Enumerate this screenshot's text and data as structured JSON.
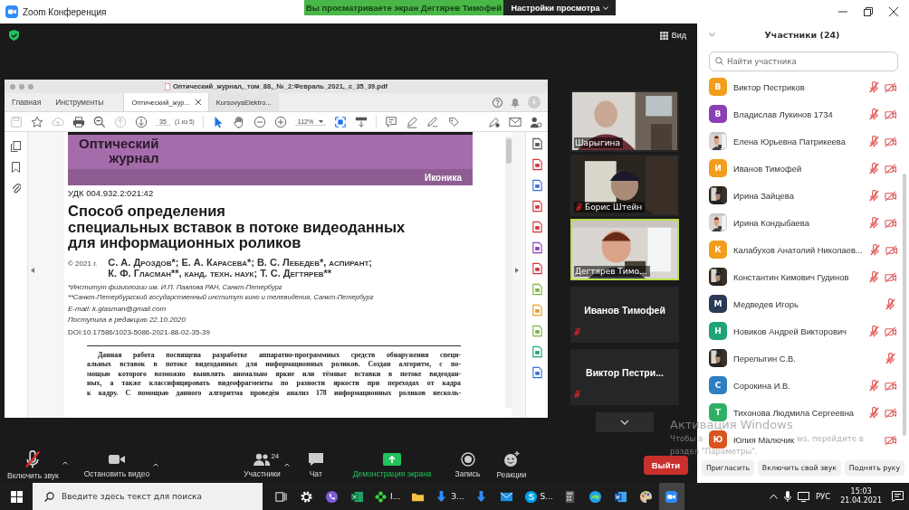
{
  "window": {
    "title": "Zoom Конференция"
  },
  "share_banner": {
    "text": "Вы просматриваете экран Дегтярев Тимофей",
    "view_options": "Настройки просмотра"
  },
  "view_button": "Вид",
  "pdf_viewer": {
    "title": "Оптический_журнал,_том_88,_№_2:Февраль_2021,_с_35_39.pdf",
    "nav": [
      {
        "label": "Главная"
      },
      {
        "label": "Инструменты"
      }
    ],
    "tabs": [
      {
        "label": "Оптический_жур...",
        "selected": true
      },
      {
        "label": "KursovyaElektro...",
        "selected": false
      }
    ],
    "page": "35",
    "page_count": "(1 из 5)",
    "zoom": "112%",
    "journal": {
      "name_lines": [
        "Оптический",
        "журнал"
      ],
      "section": "Иконика"
    },
    "udc": "УДК 004.932.2:021:42",
    "title_lines": [
      "Способ определения",
      "специальных вставок в потоке видеоданных",
      "для информационных роликов"
    ],
    "copyright": "© 2021 г.",
    "authors_lines": [
      "С. А. Дроздов*; Е. А. Карасева*; В. С. Лебедев*, аспирант;",
      "К. Ф. Гласман**, канд. техн. наук; Т. С. Дегтярев**"
    ],
    "affiliations": [
      "*Институт физиологии им. И.П. Павлова РАН, Санкт-Петербург",
      "**Санкт-Петербургский государственный институт кино и телевидения, Санкт-Петербург"
    ],
    "email": "E-mail: k.glasman@gmail.com",
    "received": "Поступила в редакцию 22.10.2020",
    "doi": "DOI:10.17586/1023-5086-2021-88-02-35-39",
    "abstract_lines": [
      "Данная работа посвящена разработке аппаратно-программных средств обнаружения специ-",
      "альных вставок в потоке видеоданных для информационных роликов. Создан алгоритм, с по-",
      "мощью которого возможно выявлять аномально яркие или тёмные вставки в потоке видеодан-",
      "ных, а также классифицировать видеофрагменты по разности яркости при переходах от кадра",
      "к кадру. С помощью данного алгоритма проведён анализ 178 информационных роликов несколь-"
    ]
  },
  "videos": [
    {
      "kind": "picture",
      "name": "Шарыгина",
      "muted": false,
      "active": false
    },
    {
      "kind": "picture",
      "name": "Борис Штейн",
      "muted": true,
      "active": false
    },
    {
      "kind": "picture",
      "name": "Дегтярев Тимо...",
      "muted": false,
      "active": true
    },
    {
      "kind": "name",
      "name": "Иванов Тимофей",
      "muted": true,
      "active": false
    },
    {
      "kind": "name",
      "name": "Виктор  Пестри...",
      "muted": true,
      "active": false
    }
  ],
  "participants": {
    "title": "Участники (24)",
    "search_placeholder": "Найти участника",
    "list": [
      {
        "kind": "letter",
        "initial": "В",
        "color": "#f29d1c",
        "name": "Виктор Пестриков",
        "mic_muted": true,
        "video_off": true
      },
      {
        "kind": "letter",
        "initial": "В",
        "color": "#8a3fb4",
        "name": "Владислав Лукинов 1734",
        "mic_muted": true,
        "video_off": true
      },
      {
        "name": "Елена Юрьевна Патрикеева",
        "mic_muted": true,
        "video_off": true
      },
      {
        "kind": "letter",
        "initial": "И",
        "color": "#f29d1c",
        "name": "Иванов Тимофей",
        "mic_muted": true,
        "video_off": true
      },
      {
        "name": "Ирина Зайцева",
        "mic_muted": true,
        "video_off": true
      },
      {
        "name": "Ирина Кондыбаева",
        "mic_muted": true,
        "video_off": true
      },
      {
        "kind": "letter",
        "initial": "К",
        "color": "#f29d1c",
        "name": "Калабухов Анатолий Николаев...",
        "mic_muted": true,
        "video_off": true
      },
      {
        "name": "Константин Кимович Гудинов",
        "mic_muted": true,
        "video_off": true
      },
      {
        "kind": "letter",
        "initial": "М",
        "color": "#2b3a55",
        "name": "Медведев Игорь",
        "mic_muted": true,
        "video_off": false
      },
      {
        "kind": "letter",
        "initial": "Н",
        "color": "#1fa37a",
        "name": "Новиков Андрей Викторович",
        "mic_muted": true,
        "video_off": true
      },
      {
        "name": "Перелыгин С.В.",
        "mic_muted": true,
        "video_off": false
      },
      {
        "kind": "letter",
        "initial": "С",
        "color": "#2d7fc1",
        "name": "Сорокина И.В.",
        "mic_muted": true,
        "video_off": true
      },
      {
        "kind": "letter",
        "initial": "Т",
        "color": "#2fb066",
        "name": "Тихонова Людмила Сергеевна",
        "mic_muted": true,
        "video_off": true
      },
      {
        "kind": "letter",
        "initial": "Ю",
        "color": "#d9541e",
        "name": "Юлия Малючик",
        "mic_muted": false,
        "video_off": true
      }
    ],
    "buttons": [
      "Пригласить",
      "Включить свой звук",
      "Поднять руку"
    ]
  },
  "toolbar": {
    "items": [
      {
        "kind": "mic",
        "label": "Включить звук",
        "muted": true,
        "caret": true
      },
      {
        "kind": "video",
        "label": "Остановить видео",
        "caret": true
      },
      {
        "kind": "participants",
        "label": "Участники",
        "count": "24",
        "caret": true
      },
      {
        "kind": "chat",
        "label": "Чат",
        "caret": false
      },
      {
        "kind": "share",
        "label": "Демонстрация экрана",
        "caret": false
      },
      {
        "kind": "record",
        "label": "Запись",
        "caret": false
      },
      {
        "kind": "reactions",
        "label": "Реакции",
        "caret": false
      }
    ],
    "leave": "Выйти"
  },
  "windows_watermark": {
    "title": "Активация Windows",
    "text_parts": [
      "Чтобы а",
      "ws, перейдите в",
      "раздел \"Параметры\"."
    ]
  },
  "taskbar": {
    "search_placeholder": "Введите здесь текст для поиска",
    "apps": [
      {
        "kind": "taskview",
        "selected": false
      },
      {
        "kind": "settings",
        "selected": false
      },
      {
        "kind": "viber",
        "selected": false
      },
      {
        "kind": "excel",
        "selected": false
      },
      {
        "kind": "flower",
        "label": "I...",
        "selected": false
      },
      {
        "kind": "folder",
        "selected": false
      },
      {
        "kind": "download",
        "label": "З...",
        "selected": false
      },
      {
        "kind": "download",
        "selected": false
      },
      {
        "kind": "mail",
        "selected": false
      },
      {
        "kind": "skype",
        "label": "S...",
        "selected": false
      },
      {
        "kind": "calculator",
        "selected": false
      },
      {
        "kind": "edge",
        "selected": false
      },
      {
        "kind": "word",
        "selected": false
      },
      {
        "kind": "paint",
        "selected": false
      },
      {
        "kind": "zoom",
        "selected": true
      }
    ],
    "language": "РУС",
    "time": "15:03",
    "date": "21.04.2021"
  }
}
